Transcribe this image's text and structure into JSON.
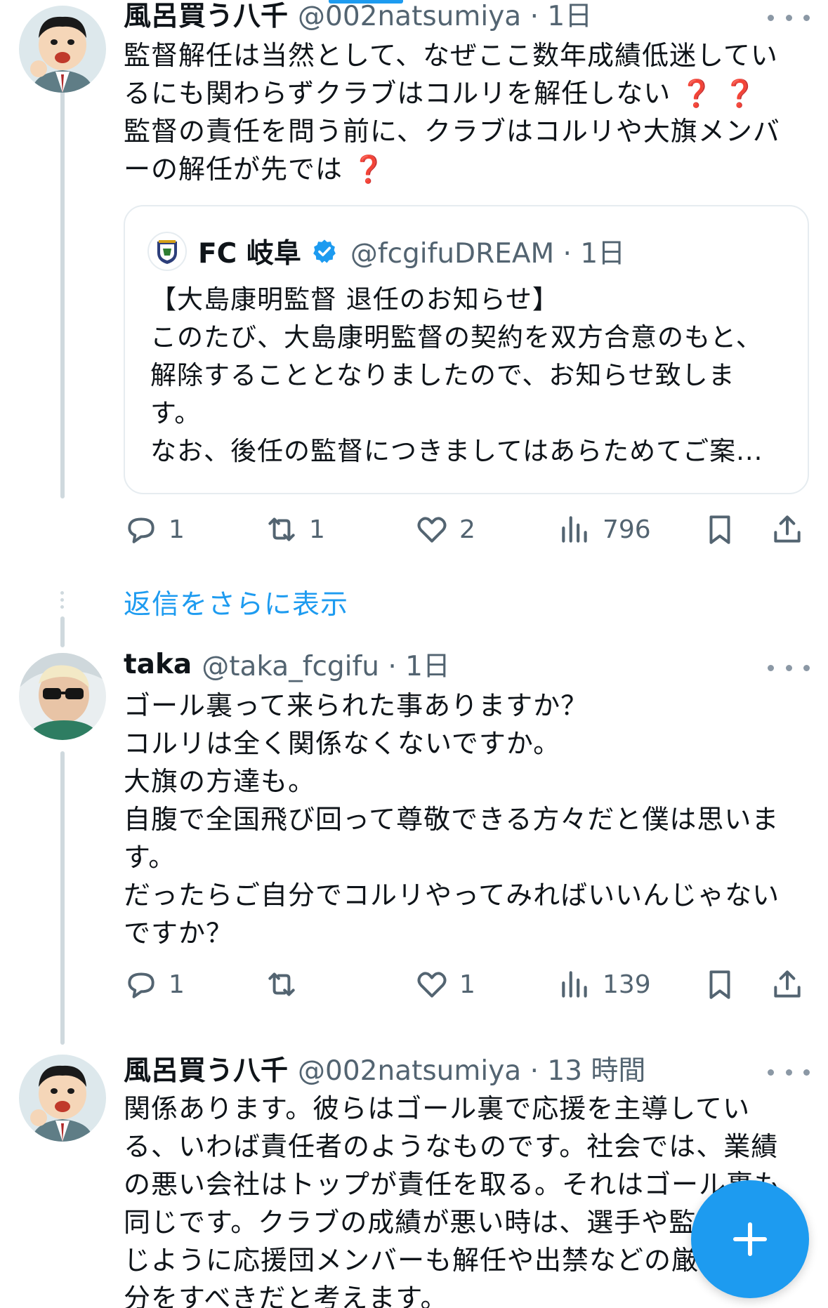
{
  "tweets": [
    {
      "name": "風呂買う八千",
      "handle": "@002natsumiya · 1日",
      "lines": [
        "監督解任は当然として、なぜここ数年成績低迷してい",
        "るにも関わらずクラブはコルリを解任しない",
        "監督の責任を問う前に、クラブはコルリや大旗メンバ",
        "ーの解任が先では"
      ],
      "emoji_qm": "❓",
      "stats": {
        "replies": "1",
        "reposts": "1",
        "likes": "2",
        "views": "796"
      }
    },
    {
      "name": "taka",
      "handle": "@taka_fcgifu · 1日",
      "lines": [
        "ゴール裏って来られた事ありますか？",
        "コルリは全く関係なくないですか。",
        "大旗の方達も。",
        "自腹で全国飛び回って尊敬できる方々だと僕は思いま",
        "す。",
        "だったらご自分でコルリやってみればいいんじゃない",
        "ですか？"
      ],
      "stats": {
        "replies": "1",
        "reposts": "",
        "likes": "1",
        "views": "139"
      }
    },
    {
      "name": "風呂買う八千",
      "handle": "@002natsumiya · 13 時間",
      "lines": [
        "関係あります。彼らはゴール裏で応援を主導してい",
        "る、いわば責任者のようなものです。社会では、業績",
        "の悪い会社はトップが責任を取る。それはゴール裏も",
        "同じです。クラブの成績が悪い時は、選手や監督と同",
        "じように応援団メンバーも解任や出禁などの厳しい処",
        "分をすべきだと考えます。"
      ]
    }
  ],
  "quote": {
    "name": "FC 岐阜",
    "handle": "@fcgifuDREAM · 1日",
    "lines": [
      "【大島康明監督 退任のお知らせ】",
      "このたび、大島康明監督の契約を双方合意のもと、",
      "解除することとなりましたので、お知らせ致しま",
      "す。",
      "なお、後任の監督につきましてはあらためてご案..."
    ]
  },
  "show_more_replies": "返信をさらに表示",
  "colors": {
    "accent": "#1d9bf0",
    "secondary_text": "#536471",
    "emoji_red": "#e0245e"
  },
  "icons": [
    "reply-icon",
    "repost-icon",
    "like-icon",
    "views-icon",
    "bookmark-icon",
    "share-icon",
    "more-icon",
    "verified-badge-icon",
    "compose-plus-icon"
  ]
}
